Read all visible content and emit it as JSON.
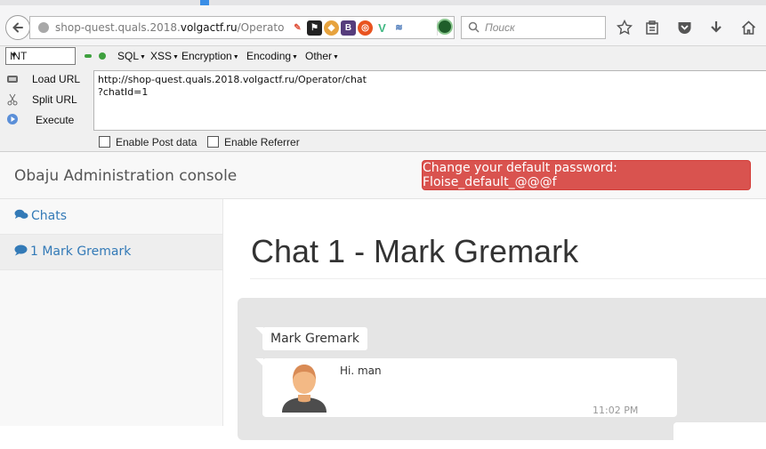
{
  "browser": {
    "url_prefix": "shop-quest.quals.2018.",
    "url_domain": "volgactf.ru",
    "url_path": "/Operator",
    "search_placeholder": "Поиск",
    "ext_icons": [
      "feather-icon",
      "flag-icon",
      "bug-icon",
      "bootstrap-icon",
      "ubuntu-icon",
      "vue-icon",
      "wave-icon"
    ],
    "toolbar_icons": [
      "star-icon",
      "clipboard-icon",
      "pocket-icon",
      "download-icon",
      "home-icon"
    ]
  },
  "hackbar": {
    "select_value": "INT",
    "menus": [
      "SQL",
      "XSS",
      "Encryption",
      "Encoding",
      "Other"
    ],
    "load_url": "Load URL",
    "split_url": "Split URL",
    "execute": "Execute",
    "url_value": "http://shop-quest.quals.2018.volgactf.ru/Operator/chat\n?chatId=1",
    "enable_post": "Enable Post data",
    "enable_referrer": "Enable Referrer"
  },
  "page": {
    "brand": "Obaju Administration console",
    "alert_button": "Change your default password: Floise_default_@@@f",
    "sidebar": [
      {
        "label": "Chats",
        "icon": "comments-icon",
        "active": false
      },
      {
        "label": "1 Mark Gremark",
        "icon": "comment-icon",
        "active": true
      }
    ],
    "chat_title": "Chat 1 - Mark Gremark",
    "messages": [
      {
        "sender": "Mark Gremark",
        "text": "Hi. man",
        "time": "11:02 PM"
      }
    ]
  },
  "colors": {
    "alert": "#d9534f",
    "link": "#337ab7",
    "panel": "#e5e5e5"
  }
}
